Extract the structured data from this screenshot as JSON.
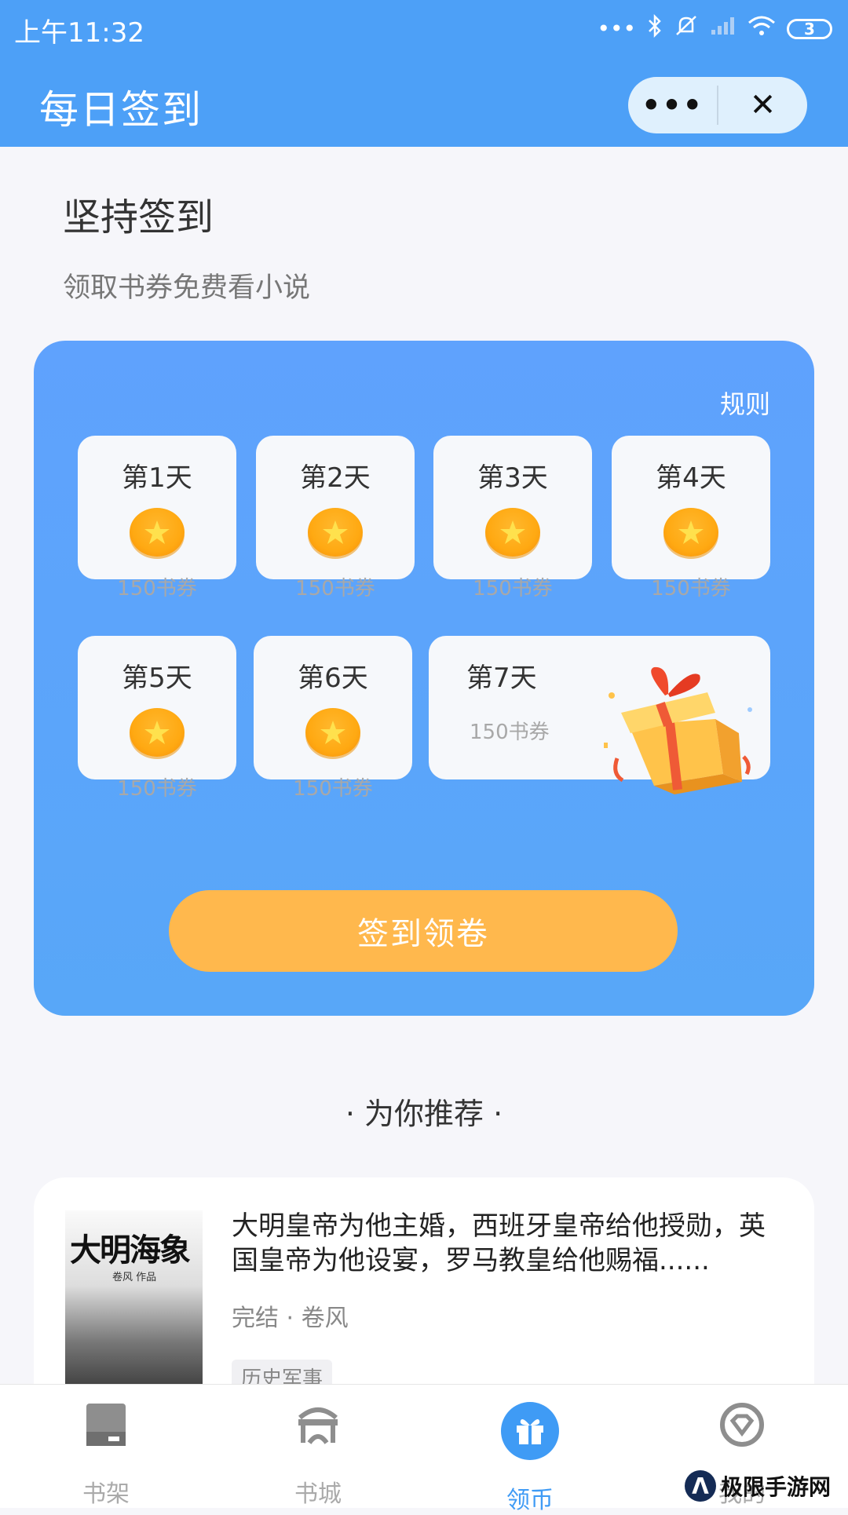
{
  "status": {
    "time": "上午11:32",
    "battery": "3"
  },
  "header": {
    "title": "每日签到",
    "more_label": "•••",
    "close_label": "✕"
  },
  "intro": {
    "title": "坚持签到",
    "subtitle": "领取书券免费看小说"
  },
  "signin": {
    "rules_label": "规则",
    "days": [
      {
        "label": "第1天",
        "amount": "150书券"
      },
      {
        "label": "第2天",
        "amount": "150书券"
      },
      {
        "label": "第3天",
        "amount": "150书券"
      },
      {
        "label": "第4天",
        "amount": "150书券"
      },
      {
        "label": "第5天",
        "amount": "150书券"
      },
      {
        "label": "第6天",
        "amount": "150书券"
      },
      {
        "label": "第7天",
        "amount": "150书券"
      }
    ],
    "button_label": "签到领卷"
  },
  "recommend": {
    "title": "· 为你推荐 ·",
    "book": {
      "cover_title": "大明海象",
      "cover_subtitle": "卷风 作品",
      "description": "大明皇帝为他主婚，西班牙皇帝给他授勋，英国皇帝为他设宴，罗马教皇给他赐福......",
      "meta": "完结 · 卷风",
      "tag": "历史军事"
    }
  },
  "tabbar": {
    "items": [
      {
        "label": "书架",
        "icon": "bookshelf-icon"
      },
      {
        "label": "书城",
        "icon": "bookstore-icon"
      },
      {
        "label": "领币",
        "icon": "gift-icon"
      },
      {
        "label": "我的",
        "icon": "diamond-icon"
      }
    ],
    "active_index": 2
  },
  "watermark": {
    "text": "极限手游网"
  },
  "colors": {
    "primary": "#4da0f7",
    "card": "#5aa4fb",
    "button": "#ffb84d",
    "active_tab": "#3f9bf5"
  }
}
